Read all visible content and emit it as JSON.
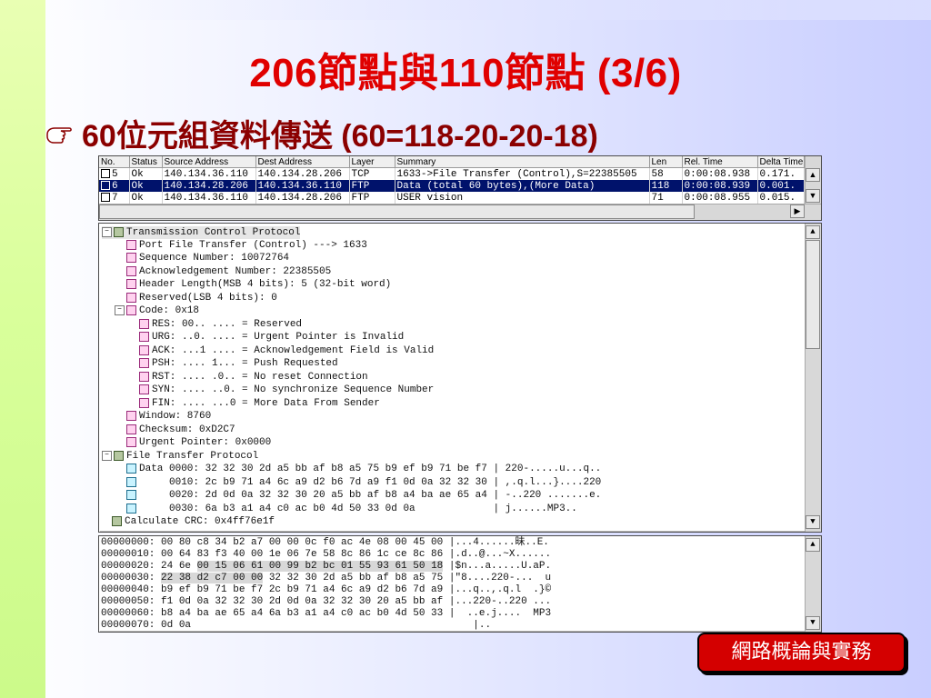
{
  "slide": {
    "title": "206節點與110節點 (3/6)",
    "bullet": "60位元組資料傳送 (60=118-20-20-18)",
    "brand": "網路概論與實務"
  },
  "packet_list": {
    "columns": [
      "No.",
      "Status",
      "Source Address",
      "Dest Address",
      "Layer",
      "Summary",
      "Len",
      "Rel. Time",
      "Delta Time"
    ],
    "rows": [
      {
        "no": "5",
        "status": "Ok",
        "src": "140.134.36.110",
        "dst": "140.134.28.206",
        "layer": "TCP",
        "summary": "1633->File Transfer (Control),S=22385505",
        "len": "58",
        "rel": "0:00:08.938",
        "delta": "0.171."
      },
      {
        "no": "6",
        "status": "Ok",
        "src": "140.134.28.206",
        "dst": "140.134.36.110",
        "layer": "FTP",
        "summary": "Data (total 60 bytes),(More Data)",
        "len": "118",
        "rel": "0:00:08.939",
        "delta": "0.001."
      },
      {
        "no": "7",
        "status": "Ok",
        "src": "140.134.36.110",
        "dst": "140.134.28.206",
        "layer": "FTP",
        "summary": "USER vision",
        "len": "71",
        "rel": "0:00:08.955",
        "delta": "0.015."
      }
    ]
  },
  "tree": [
    "Transmission Control Protocol",
    "Port File Transfer (Control) ---> 1633",
    "Sequence Number: 10072764",
    "Acknowledgement Number: 22385505",
    "Header Length(MSB 4 bits): 5 (32-bit word)",
    "Reserved(LSB 4 bits): 0",
    "Code: 0x18",
    "RES: 00.. .... = Reserved",
    "URG: ..0. .... = Urgent Pointer is Invalid",
    "ACK: ...1 .... = Acknowledgement Field is Valid",
    "PSH: .... 1... = Push Requested",
    "RST: .... .0.. = No reset Connection",
    "SYN: .... ..0. = No synchronize Sequence Number",
    "FIN: .... ...0 = More Data From Sender",
    "Window: 8760",
    "Checksum: 0xD2C7",
    "Urgent Pointer: 0x0000",
    "File Transfer Protocol",
    "Data 0000: 32 32 30 2d a5 bb af b8 a5 75 b9 ef b9 71 be f7 | 220-.....u...q..",
    "     0010: 2c b9 71 a4 6c a9 d2 b6 7d a9 f1 0d 0a 32 32 30 | ,.q.l...}....220",
    "     0020: 2d 0d 0a 32 32 30 20 a5 bb af b8 a4 ba ae 65 a4 | -..220 .......e.",
    "     0030: 6a b3 a1 a4 c0 ac b0 4d 50 33 0d 0a             | j......MP3..",
    "Calculate CRC: 0x4ff76e1f"
  ],
  "hex": [
    {
      "a": "00000000: 00 80 c8 34 b2 a7 00 00 0c f0 ac 4e 08 00 45 00 ",
      "b": "",
      "c": "",
      "d": "|...4......昧..E."
    },
    {
      "a": "00000010: 00 64 83 f3 40 00 1e 06 7e 58 8c 86 1c ce 8c 86 ",
      "b": "",
      "c": "",
      "d": "|.d..@...~X......"
    },
    {
      "a": "00000020: 24 6e ",
      "b": "00 15 06 61 00 99 b2 bc 01 55 93 61 50 18",
      "c": " ",
      "d": "|$n...a.....U.aP."
    },
    {
      "a": "00000030: ",
      "b": "22 38 d2 c7 00 00",
      "c": " 32 32 30 2d a5 bb af b8 a5 75 ",
      "d": "|\"8....220-...  u"
    },
    {
      "a": "00000040: b9 ef b9 71 be f7 2c b9 71 a4 6c a9 d2 b6 7d a9 ",
      "b": "",
      "c": "",
      "d": "|...q..,.q.l  .}©"
    },
    {
      "a": "00000050: f1 0d 0a 32 32 30 2d 0d 0a 32 32 30 20 a5 bb af ",
      "b": "",
      "c": "",
      "d": "|...220-..220 ..."
    },
    {
      "a": "00000060: b8 a4 ba ae 65 a4 6a b3 a1 a4 c0 ac b0 4d 50 33 ",
      "b": "",
      "c": "",
      "d": "|  ..e.j....  MP3"
    },
    {
      "a": "00000070: 0d 0a",
      "b": "",
      "c": "",
      "d": "                                               |.."
    }
  ]
}
